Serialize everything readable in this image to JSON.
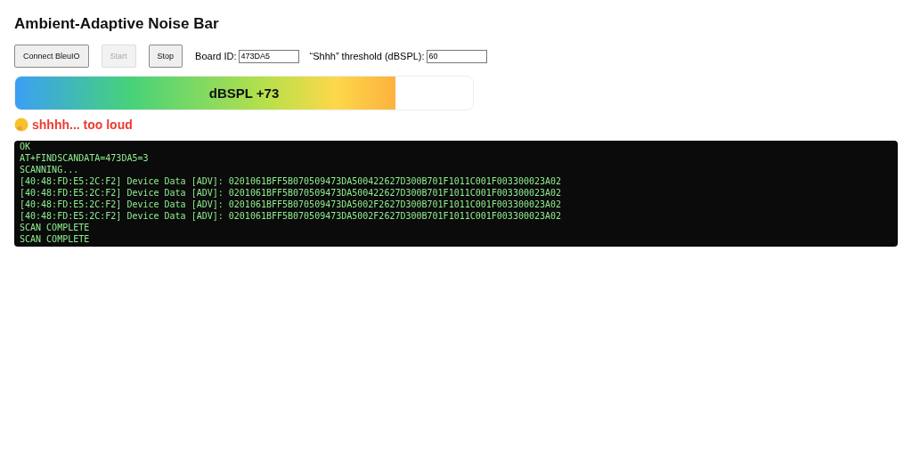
{
  "title": "Ambient-Adaptive Noise Bar",
  "buttons": [
    {
      "label": "Connect BleuIO",
      "disabled": false
    },
    {
      "label": "Start",
      "disabled": true
    },
    {
      "label": "Stop",
      "disabled": false
    }
  ],
  "fields": [
    {
      "label": "Board ID:",
      "value": "473DA5"
    },
    {
      "label": "“Shhh” threshold (dBSPL):",
      "value": "60"
    }
  ],
  "meter": {
    "label": "dBSPL +73",
    "level": 0.83
  },
  "alert": {
    "text": "shhhh... too loud"
  },
  "console": {
    "lines": [
      "OK",
      "AT+FINDSCANDATA=473DA5=3",
      "SCANNING...",
      "[40:48:FD:E5:2C:F2] Device Data [ADV]: 0201061BFF5B070509473DA500422627D300B701F1011C001F003300023A02",
      "[40:48:FD:E5:2C:F2] Device Data [ADV]: 0201061BFF5B070509473DA500422627D300B701F1011C001F003300023A02",
      "[40:48:FD:E5:2C:F2] Device Data [ADV]: 0201061BFF5B070509473DA5002F2627D300B701F1011C001F003300023A02",
      "[40:48:FD:E5:2C:F2] Device Data [ADV]: 0201061BFF5B070509473DA5002F2627D300B701F1011C001F003300023A02",
      "SCAN COMPLETE",
      "SCAN COMPLETE"
    ]
  }
}
